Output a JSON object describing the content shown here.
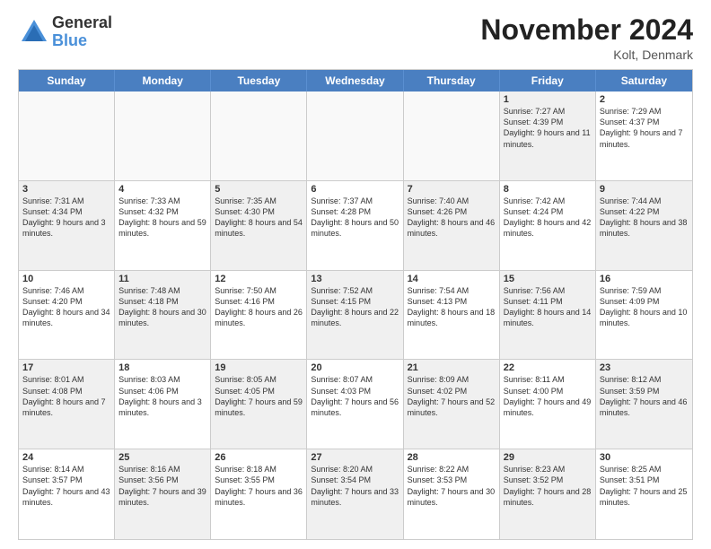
{
  "header": {
    "logo_general": "General",
    "logo_blue": "Blue",
    "month_title": "November 2024",
    "location": "Kolt, Denmark"
  },
  "calendar": {
    "days_of_week": [
      "Sunday",
      "Monday",
      "Tuesday",
      "Wednesday",
      "Thursday",
      "Friday",
      "Saturday"
    ],
    "rows": [
      [
        {
          "day": "",
          "text": "",
          "empty": true
        },
        {
          "day": "",
          "text": "",
          "empty": true
        },
        {
          "day": "",
          "text": "",
          "empty": true
        },
        {
          "day": "",
          "text": "",
          "empty": true
        },
        {
          "day": "",
          "text": "",
          "empty": true
        },
        {
          "day": "1",
          "text": "Sunrise: 7:27 AM\nSunset: 4:39 PM\nDaylight: 9 hours and 11 minutes.",
          "empty": false,
          "shaded": true
        },
        {
          "day": "2",
          "text": "Sunrise: 7:29 AM\nSunset: 4:37 PM\nDaylight: 9 hours and 7 minutes.",
          "empty": false,
          "shaded": false
        }
      ],
      [
        {
          "day": "3",
          "text": "Sunrise: 7:31 AM\nSunset: 4:34 PM\nDaylight: 9 hours and 3 minutes.",
          "empty": false,
          "shaded": true
        },
        {
          "day": "4",
          "text": "Sunrise: 7:33 AM\nSunset: 4:32 PM\nDaylight: 8 hours and 59 minutes.",
          "empty": false,
          "shaded": false
        },
        {
          "day": "5",
          "text": "Sunrise: 7:35 AM\nSunset: 4:30 PM\nDaylight: 8 hours and 54 minutes.",
          "empty": false,
          "shaded": true
        },
        {
          "day": "6",
          "text": "Sunrise: 7:37 AM\nSunset: 4:28 PM\nDaylight: 8 hours and 50 minutes.",
          "empty": false,
          "shaded": false
        },
        {
          "day": "7",
          "text": "Sunrise: 7:40 AM\nSunset: 4:26 PM\nDaylight: 8 hours and 46 minutes.",
          "empty": false,
          "shaded": true
        },
        {
          "day": "8",
          "text": "Sunrise: 7:42 AM\nSunset: 4:24 PM\nDaylight: 8 hours and 42 minutes.",
          "empty": false,
          "shaded": false
        },
        {
          "day": "9",
          "text": "Sunrise: 7:44 AM\nSunset: 4:22 PM\nDaylight: 8 hours and 38 minutes.",
          "empty": false,
          "shaded": true
        }
      ],
      [
        {
          "day": "10",
          "text": "Sunrise: 7:46 AM\nSunset: 4:20 PM\nDaylight: 8 hours and 34 minutes.",
          "empty": false,
          "shaded": false
        },
        {
          "day": "11",
          "text": "Sunrise: 7:48 AM\nSunset: 4:18 PM\nDaylight: 8 hours and 30 minutes.",
          "empty": false,
          "shaded": true
        },
        {
          "day": "12",
          "text": "Sunrise: 7:50 AM\nSunset: 4:16 PM\nDaylight: 8 hours and 26 minutes.",
          "empty": false,
          "shaded": false
        },
        {
          "day": "13",
          "text": "Sunrise: 7:52 AM\nSunset: 4:15 PM\nDaylight: 8 hours and 22 minutes.",
          "empty": false,
          "shaded": true
        },
        {
          "day": "14",
          "text": "Sunrise: 7:54 AM\nSunset: 4:13 PM\nDaylight: 8 hours and 18 minutes.",
          "empty": false,
          "shaded": false
        },
        {
          "day": "15",
          "text": "Sunrise: 7:56 AM\nSunset: 4:11 PM\nDaylight: 8 hours and 14 minutes.",
          "empty": false,
          "shaded": true
        },
        {
          "day": "16",
          "text": "Sunrise: 7:59 AM\nSunset: 4:09 PM\nDaylight: 8 hours and 10 minutes.",
          "empty": false,
          "shaded": false
        }
      ],
      [
        {
          "day": "17",
          "text": "Sunrise: 8:01 AM\nSunset: 4:08 PM\nDaylight: 8 hours and 7 minutes.",
          "empty": false,
          "shaded": true
        },
        {
          "day": "18",
          "text": "Sunrise: 8:03 AM\nSunset: 4:06 PM\nDaylight: 8 hours and 3 minutes.",
          "empty": false,
          "shaded": false
        },
        {
          "day": "19",
          "text": "Sunrise: 8:05 AM\nSunset: 4:05 PM\nDaylight: 7 hours and 59 minutes.",
          "empty": false,
          "shaded": true
        },
        {
          "day": "20",
          "text": "Sunrise: 8:07 AM\nSunset: 4:03 PM\nDaylight: 7 hours and 56 minutes.",
          "empty": false,
          "shaded": false
        },
        {
          "day": "21",
          "text": "Sunrise: 8:09 AM\nSunset: 4:02 PM\nDaylight: 7 hours and 52 minutes.",
          "empty": false,
          "shaded": true
        },
        {
          "day": "22",
          "text": "Sunrise: 8:11 AM\nSunset: 4:00 PM\nDaylight: 7 hours and 49 minutes.",
          "empty": false,
          "shaded": false
        },
        {
          "day": "23",
          "text": "Sunrise: 8:12 AM\nSunset: 3:59 PM\nDaylight: 7 hours and 46 minutes.",
          "empty": false,
          "shaded": true
        }
      ],
      [
        {
          "day": "24",
          "text": "Sunrise: 8:14 AM\nSunset: 3:57 PM\nDaylight: 7 hours and 43 minutes.",
          "empty": false,
          "shaded": false
        },
        {
          "day": "25",
          "text": "Sunrise: 8:16 AM\nSunset: 3:56 PM\nDaylight: 7 hours and 39 minutes.",
          "empty": false,
          "shaded": true
        },
        {
          "day": "26",
          "text": "Sunrise: 8:18 AM\nSunset: 3:55 PM\nDaylight: 7 hours and 36 minutes.",
          "empty": false,
          "shaded": false
        },
        {
          "day": "27",
          "text": "Sunrise: 8:20 AM\nSunset: 3:54 PM\nDaylight: 7 hours and 33 minutes.",
          "empty": false,
          "shaded": true
        },
        {
          "day": "28",
          "text": "Sunrise: 8:22 AM\nSunset: 3:53 PM\nDaylight: 7 hours and 30 minutes.",
          "empty": false,
          "shaded": false
        },
        {
          "day": "29",
          "text": "Sunrise: 8:23 AM\nSunset: 3:52 PM\nDaylight: 7 hours and 28 minutes.",
          "empty": false,
          "shaded": true
        },
        {
          "day": "30",
          "text": "Sunrise: 8:25 AM\nSunset: 3:51 PM\nDaylight: 7 hours and 25 minutes.",
          "empty": false,
          "shaded": false
        }
      ]
    ]
  }
}
